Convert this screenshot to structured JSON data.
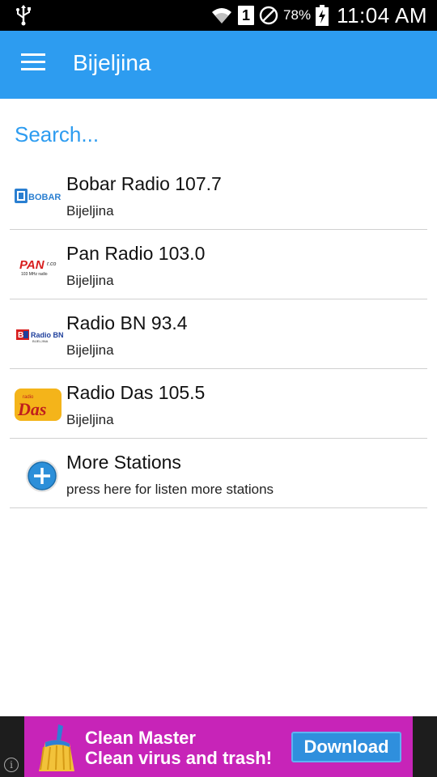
{
  "status_bar": {
    "battery_percent": "78%",
    "sim_slot": "1",
    "time": "11:04 AM",
    "icons": [
      "usb-icon",
      "wifi-icon",
      "sim-icon",
      "do-not-disturb-icon",
      "battery-charging-icon"
    ]
  },
  "app_bar": {
    "title": "Bijeljina",
    "background_color": "#2d9cf0"
  },
  "search": {
    "placeholder": "Search..."
  },
  "stations": [
    {
      "name": "Bobar Radio 107.7",
      "city": "Bijeljina",
      "logo": "bobar-logo"
    },
    {
      "name": "Pan Radio 103.0",
      "city": "Bijeljina",
      "logo": "pan-radio-logo"
    },
    {
      "name": "Radio BN 93.4",
      "city": "Bijeljina",
      "logo": "radio-bn-logo"
    },
    {
      "name": "Radio Das 105.5",
      "city": "Bijeljina",
      "logo": "radio-das-logo"
    }
  ],
  "more_stations": {
    "title": "More Stations",
    "subtitle": "press here for listen more stations",
    "icon": "add-circle-icon"
  },
  "ad": {
    "line1": "Clean Master",
    "line2": "Clean virus and trash!",
    "button": "Download",
    "background_color": "#c724b8",
    "icon": "broom-icon"
  }
}
